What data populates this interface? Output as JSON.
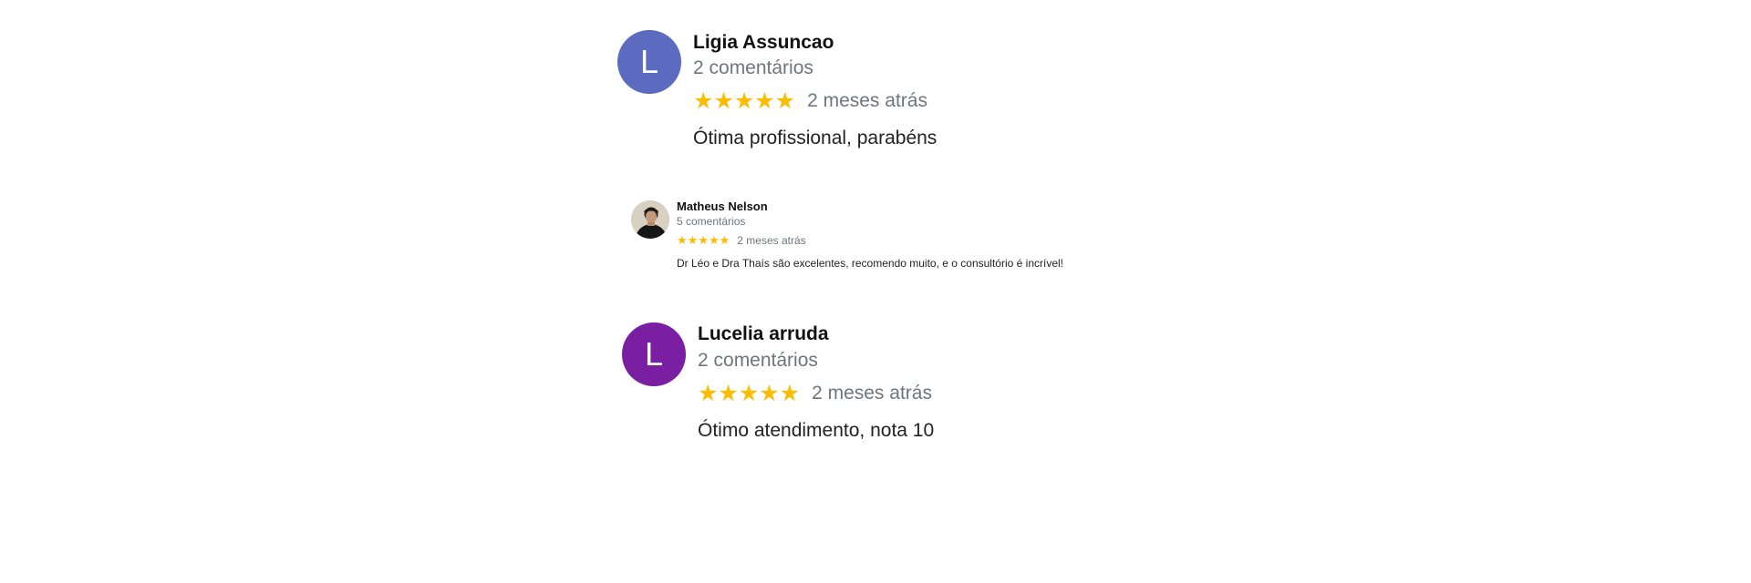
{
  "reviews": [
    {
      "name": "Ligia Assuncao",
      "avatar_initial": "L",
      "avatar_color": "#5c6bc0",
      "comments": "2 comentários",
      "stars": "★★★★★",
      "rating": 5,
      "date": "2 meses atrás",
      "text": "Ótima profissional, parabéns"
    },
    {
      "name": "Matheus Nelson",
      "avatar_type": "photo",
      "comments": "5 comentários",
      "stars": "★★★★★",
      "rating": 5,
      "date": "2 meses atrás",
      "text": "Dr Léo e Dra Thaís são excelentes, recomendo muito, e o consultório é incrível!"
    },
    {
      "name": "Lucelia arruda",
      "avatar_initial": "L",
      "avatar_color": "#7b1fa2",
      "comments": "2 comentários",
      "stars": "★★★★★",
      "rating": 5,
      "date": "2 meses atrás",
      "text": "Ótimo atendimento, nota 10"
    }
  ],
  "colors": {
    "star": "#fbbc04",
    "meta_text": "#70757a"
  }
}
